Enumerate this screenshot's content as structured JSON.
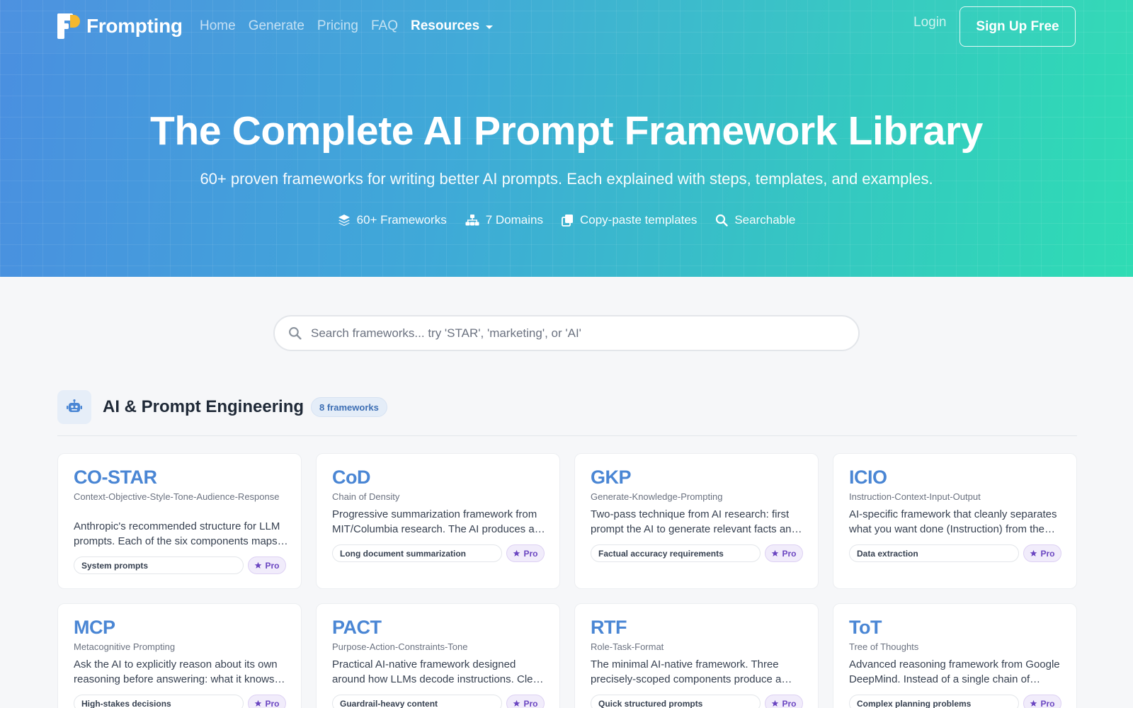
{
  "brand": {
    "name": "Frompting"
  },
  "nav": {
    "items": [
      "Home",
      "Generate",
      "Pricing",
      "FAQ"
    ],
    "resources": "Resources",
    "login": "Login",
    "signup": "Sign Up Free"
  },
  "hero": {
    "title": "The Complete AI Prompt Framework Library",
    "subtitle": "60+ proven frameworks for writing better AI prompts. Each explained with steps, templates, and examples.",
    "features": [
      {
        "icon": "layers-icon",
        "label": "60+ Frameworks"
      },
      {
        "icon": "sitemap-icon",
        "label": "7 Domains"
      },
      {
        "icon": "copy-icon",
        "label": "Copy-paste templates"
      },
      {
        "icon": "search-icon",
        "label": "Searchable"
      }
    ]
  },
  "search": {
    "placeholder": "Search frameworks... try 'STAR', 'marketing', or 'AI'",
    "value": ""
  },
  "section": {
    "icon": "robot-icon",
    "title": "AI & Prompt Engineering",
    "count": "8 frameworks"
  },
  "cards": [
    {
      "abbr": "CO-STAR",
      "full": "Context-Objective-Style-Tone-Audience-Response",
      "desc": "Anthropic's recommended structure for LLM prompts. Each of the six components maps to a distinct part of the prompt.",
      "tag": "System prompts",
      "badge": "Pro"
    },
    {
      "abbr": "CoD",
      "full": "Chain of Density",
      "desc": "Progressive summarization framework from MIT/Columbia research. The AI produces a series of increasingly dense summaries.",
      "tag": "Long document summarization",
      "badge": "Pro"
    },
    {
      "abbr": "GKP",
      "full": "Generate-Knowledge-Prompting",
      "desc": "Two-pass technique from AI research: first prompt the AI to generate relevant facts and then answer.",
      "tag": "Factual accuracy requirements",
      "badge": "Pro"
    },
    {
      "abbr": "ICIO",
      "full": "Instruction-Context-Input-Output",
      "desc": "AI-specific framework that cleanly separates what you want done (Instruction) from the rest.",
      "tag": "Data extraction",
      "badge": "Pro"
    },
    {
      "abbr": "MCP",
      "full": "Metacognitive Prompting",
      "desc": "Ask the AI to explicitly reason about its own reasoning before answering: what it knows and doesn't.",
      "tag": "High-stakes decisions",
      "badge": "Pro"
    },
    {
      "abbr": "PACT",
      "full": "Purpose-Action-Constraints-Tone",
      "desc": "Practical AI-native framework designed around how LLMs decode instructions. Clear and concise.",
      "tag": "Guardrail-heavy content",
      "badge": "Pro"
    },
    {
      "abbr": "RTF",
      "full": "Role-Task-Format",
      "desc": "The minimal AI-native framework. Three precisely-scoped components produce a reliable result.",
      "tag": "Quick structured prompts",
      "badge": "Pro"
    },
    {
      "abbr": "ToT",
      "full": "Tree of Thoughts",
      "desc": "Advanced reasoning framework from Google DeepMind. Instead of a single chain of thought it explores branches.",
      "tag": "Complex planning problems",
      "badge": "Pro"
    }
  ],
  "colors": {
    "accent": "#4a86d4",
    "pro_badge": "#6b46c1",
    "hero_start": "#4a8fe0",
    "hero_end": "#2fdcb4"
  }
}
